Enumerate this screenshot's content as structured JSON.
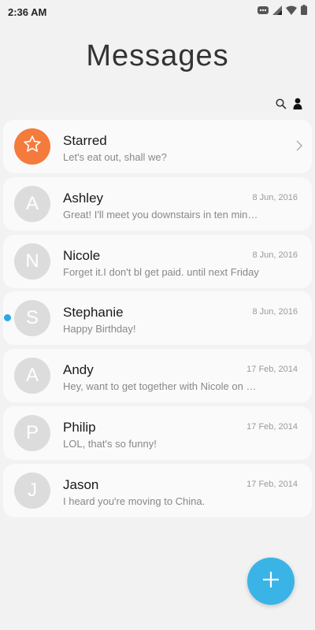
{
  "status_bar": {
    "time": "2:36 AM",
    "icons": [
      "notification-icon",
      "signal-icon",
      "wifi-icon",
      "battery-icon"
    ]
  },
  "header": {
    "title": "Messages",
    "actions": [
      "search-icon",
      "contacts-icon"
    ]
  },
  "colors": {
    "accent": "#3ab4e6",
    "starred": "#f47b3c",
    "unread": "#2aa7e6",
    "avatar_bg": "#dcdcdc"
  },
  "conversations": [
    {
      "initial": "",
      "icon": "star-icon",
      "name": "Starred",
      "preview": "Let's eat out, shall we?",
      "date": "",
      "unread": false
    },
    {
      "initial": "A",
      "name": "Ashley",
      "preview": "Great! I'll meet you downstairs in ten minutes.",
      "date": "8 Jun, 2016",
      "unread": false
    },
    {
      "initial": "N",
      "name": "Nicole",
      "preview": "Forget it.I don't bl get paid. until next Friday",
      "date": "8 Jun, 2016",
      "unread": false
    },
    {
      "initial": "S",
      "name": "Stephanie",
      "preview": "Happy Birthday!",
      "date": "8 Jun, 2016",
      "unread": true
    },
    {
      "initial": "A",
      "name": "Andy",
      "preview": "Hey, want to get together with Nicole on Friday?",
      "date": "17 Feb, 2014",
      "unread": false
    },
    {
      "initial": "P",
      "name": "Philip",
      "preview": "LOL, that's so funny!",
      "date": "17 Feb, 2014",
      "unread": false
    },
    {
      "initial": "J",
      "name": "Jason",
      "preview": "I heard you're moving to China.",
      "date": "17 Feb, 2014",
      "unread": false
    }
  ],
  "fab": {
    "icon": "plus-icon"
  }
}
